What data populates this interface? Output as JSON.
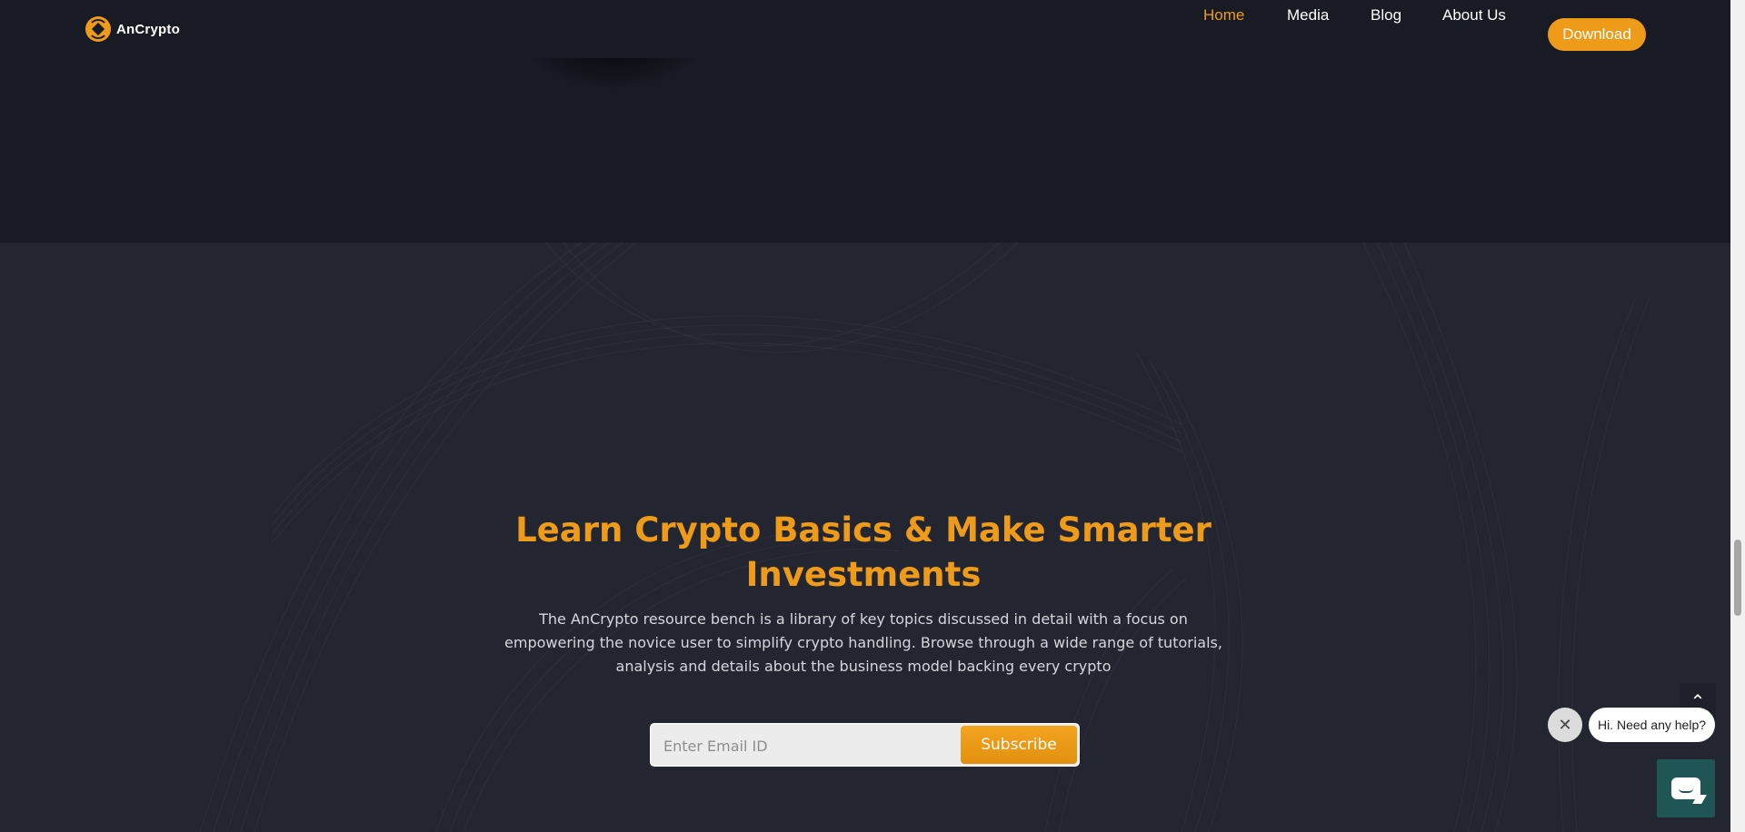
{
  "header": {
    "logo_text": "AnCrypto",
    "nav": [
      {
        "label": "Home",
        "active": true
      },
      {
        "label": "Media"
      },
      {
        "label": "Blog"
      },
      {
        "label": "About Us"
      }
    ],
    "download_label": "Download"
  },
  "learn": {
    "headline": "Learn Crypto Basics & Make Smarter Investments",
    "description": "The AnCrypto resource bench is a library of key topics discussed in detail with a focus on empowering the novice user to simplify crypto handling. Browse through a wide range of tutorials, analysis and details about the business model backing every crypto",
    "email_placeholder": "Enter Email ID",
    "subscribe_label": "Subscribe"
  },
  "chat": {
    "greeting": "Hi. Need any help?",
    "close_icon": "close-icon",
    "launcher_icon": "chat-icon"
  },
  "colors": {
    "accent": "#ee9b1a",
    "background_dark": "#181a24",
    "section_bg": "#232631",
    "chat_green": "#1f5555"
  }
}
